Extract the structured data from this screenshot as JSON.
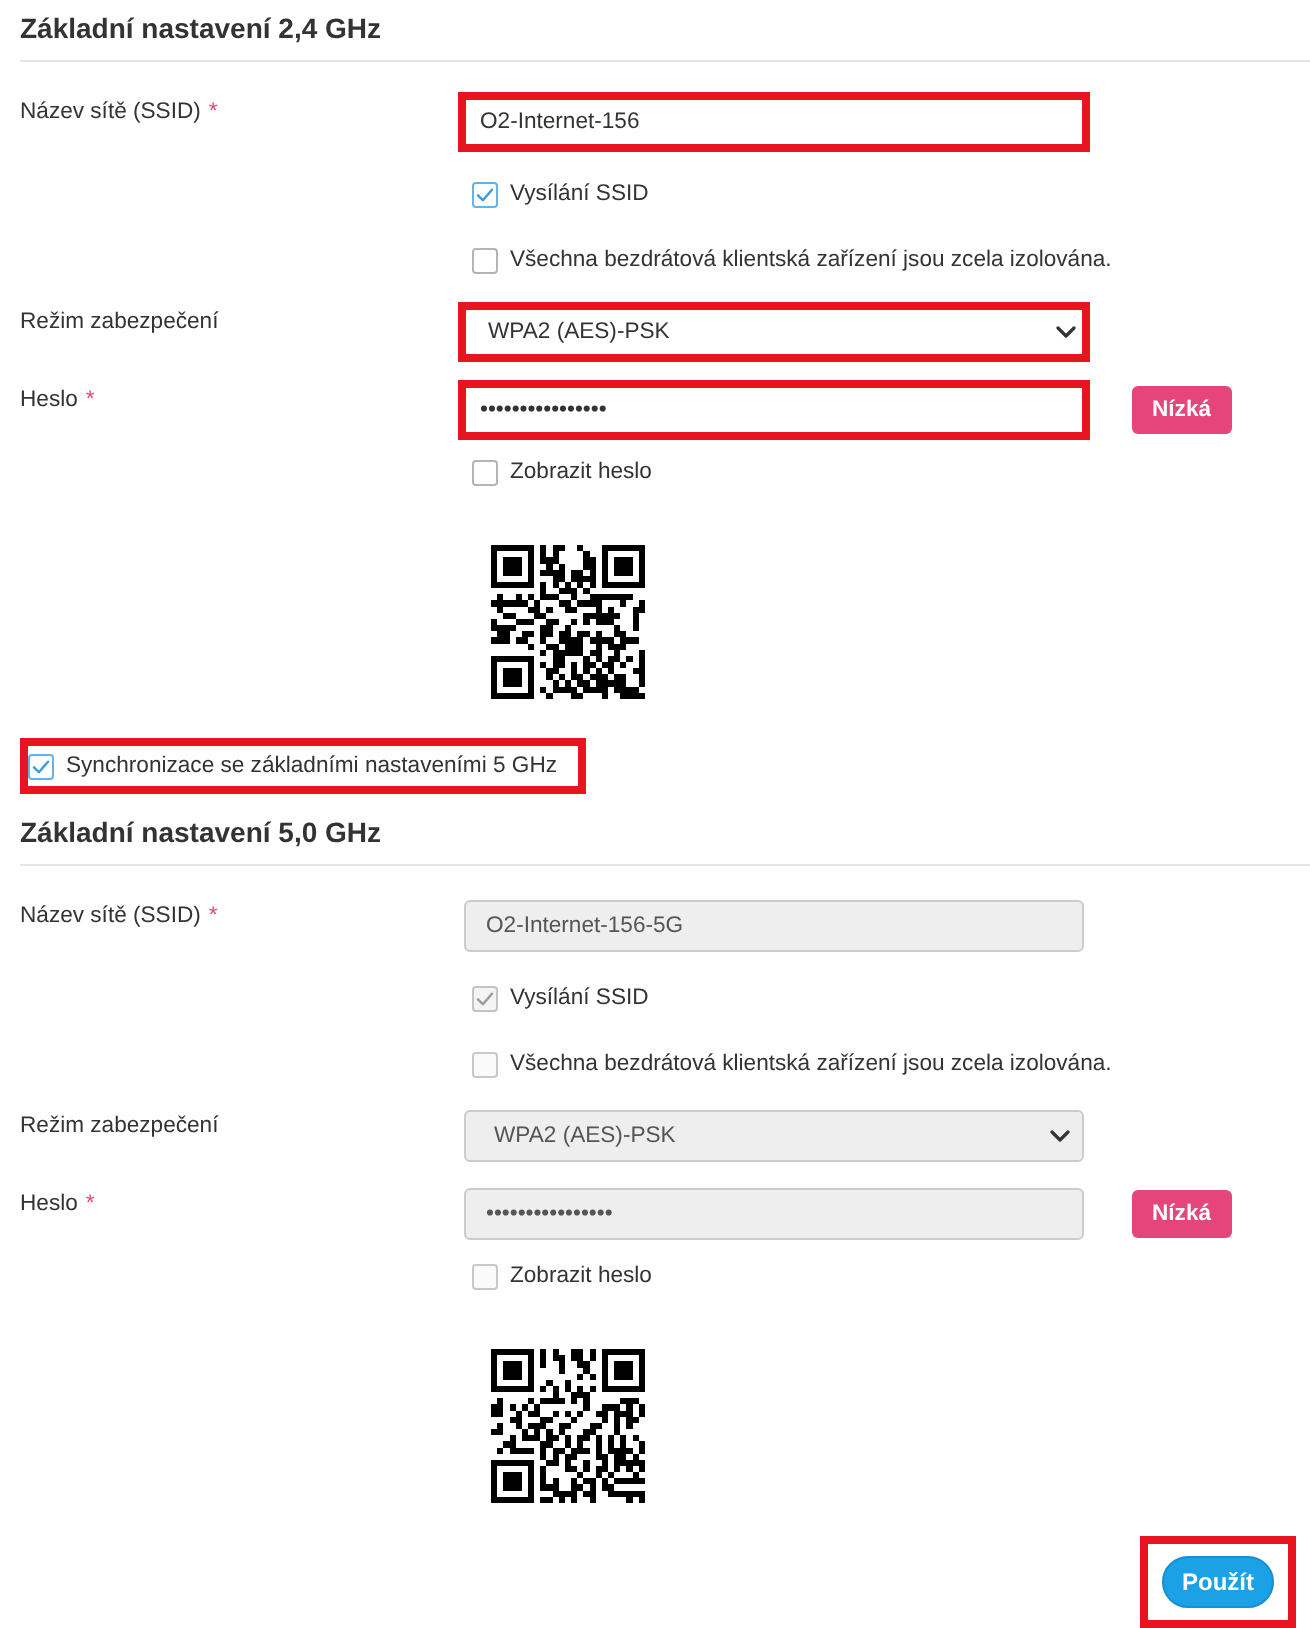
{
  "wifi_24ghz": {
    "title": "Základní nastavení 2,4 GHz",
    "fields": [
      {
        "kind": "text",
        "label": "Název sítě (SSID)",
        "required_mark": "*",
        "value": "O2-Internet-156",
        "disabled": false,
        "highlighted": true
      },
      {
        "kind": "checkbox",
        "label": "Vysílání SSID",
        "checked": true,
        "disabled": false
      },
      {
        "kind": "checkbox",
        "label": "Všechna bezdrátová klientská zařízení jsou zcela izolována.",
        "checked": false,
        "disabled": false
      },
      {
        "kind": "select",
        "label": "Režim zabezpečení",
        "value": "WPA2 (AES)-PSK",
        "disabled": false,
        "highlighted": true
      },
      {
        "kind": "password",
        "label": "Heslo",
        "required_mark": "*",
        "value": "••••••••••••••••",
        "strength": "Nízká",
        "disabled": false,
        "highlighted": true
      },
      {
        "kind": "checkbox",
        "label": "Zobrazit heslo",
        "checked": false,
        "disabled": false
      },
      {
        "kind": "qr"
      }
    ]
  },
  "sync_option": {
    "label": "Synchronizace se základními nastaveními 5 GHz",
    "checked": true,
    "highlighted": true
  },
  "wifi_5ghz": {
    "title": "Základní nastavení 5,0 GHz",
    "fields": [
      {
        "kind": "text",
        "label": "Název sítě (SSID)",
        "required_mark": "*",
        "value": "O2-Internet-156-5G",
        "disabled": true,
        "highlighted": false
      },
      {
        "kind": "checkbox",
        "label": "Vysílání SSID",
        "checked": true,
        "disabled": true
      },
      {
        "kind": "checkbox",
        "label": "Všechna bezdrátová klientská zařízení jsou zcela izolována.",
        "checked": false,
        "disabled": true
      },
      {
        "kind": "select",
        "label": "Režim zabezpečení",
        "value": "WPA2 (AES)-PSK",
        "disabled": true,
        "highlighted": false
      },
      {
        "kind": "password",
        "label": "Heslo",
        "required_mark": "*",
        "value": "••••••••••••••••",
        "strength": "Nízká",
        "disabled": true,
        "highlighted": false
      },
      {
        "kind": "checkbox",
        "label": "Zobrazit heslo",
        "checked": false,
        "disabled": true
      },
      {
        "kind": "qr"
      }
    ]
  },
  "apply_button": {
    "label": "Použít",
    "highlighted": true
  }
}
